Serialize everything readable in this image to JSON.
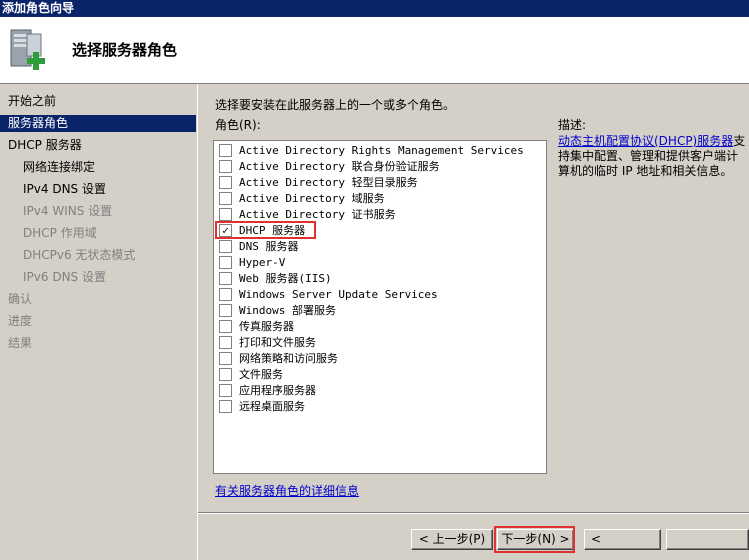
{
  "window": {
    "title": "添加角色向导"
  },
  "header": {
    "title": "选择服务器角色",
    "icon": "server-add-icon"
  },
  "sidebar": {
    "items": [
      {
        "label": "开始之前",
        "state": "normal",
        "indent": 0
      },
      {
        "label": "服务器角色",
        "state": "selected",
        "indent": 0
      },
      {
        "label": "DHCP 服务器",
        "state": "normal",
        "indent": 0
      },
      {
        "label": "网络连接绑定",
        "state": "normal",
        "indent": 1
      },
      {
        "label": "IPv4 DNS 设置",
        "state": "normal",
        "indent": 1
      },
      {
        "label": "IPv4 WINS 设置",
        "state": "disabled",
        "indent": 1
      },
      {
        "label": "DHCP 作用域",
        "state": "disabled",
        "indent": 1
      },
      {
        "label": "DHCPv6 无状态模式",
        "state": "disabled",
        "indent": 1
      },
      {
        "label": "IPv6 DNS 设置",
        "state": "disabled",
        "indent": 1
      },
      {
        "label": "确认",
        "state": "disabled",
        "indent": 0
      },
      {
        "label": "进度",
        "state": "disabled",
        "indent": 0
      },
      {
        "label": "结果",
        "state": "disabled",
        "indent": 0
      }
    ]
  },
  "main": {
    "instruction": "选择要安装在此服务器上的一个或多个角色。",
    "roles_label": "角色(R):",
    "roles": [
      {
        "label": "Active Directory Rights Management Services",
        "checked": false
      },
      {
        "label": "Active Directory 联合身份验证服务",
        "checked": false
      },
      {
        "label": "Active Directory 轻型目录服务",
        "checked": false
      },
      {
        "label": "Active Directory 域服务",
        "checked": false
      },
      {
        "label": "Active Directory 证书服务",
        "checked": false
      },
      {
        "label": "DHCP 服务器",
        "checked": true
      },
      {
        "label": "DNS 服务器",
        "checked": false
      },
      {
        "label": "Hyper-V",
        "checked": false
      },
      {
        "label": "Web 服务器(IIS)",
        "checked": false
      },
      {
        "label": "Windows Server Update Services",
        "checked": false
      },
      {
        "label": "Windows 部署服务",
        "checked": false
      },
      {
        "label": "传真服务器",
        "checked": false
      },
      {
        "label": "打印和文件服务",
        "checked": false
      },
      {
        "label": "网络策略和访问服务",
        "checked": false
      },
      {
        "label": "文件服务",
        "checked": false
      },
      {
        "label": "应用程序服务器",
        "checked": false
      },
      {
        "label": "远程桌面服务",
        "checked": false
      }
    ],
    "details_link": "有关服务器角色的详细信息",
    "description": {
      "label": "描述:",
      "link": "动态主机配置协议(DHCP)服务器",
      "text": "支持集中配置、管理和提供客户端计算机的临时 IP 地址和相关信息。"
    }
  },
  "buttons": {
    "back": "< 上一步(P)",
    "next": "下一步(N) >",
    "install": "<",
    "cancel": ""
  },
  "colors": {
    "titlebar": "#0a246a",
    "selection": "#0a246a",
    "highlight": "#e03030",
    "link": "#0000cc"
  }
}
